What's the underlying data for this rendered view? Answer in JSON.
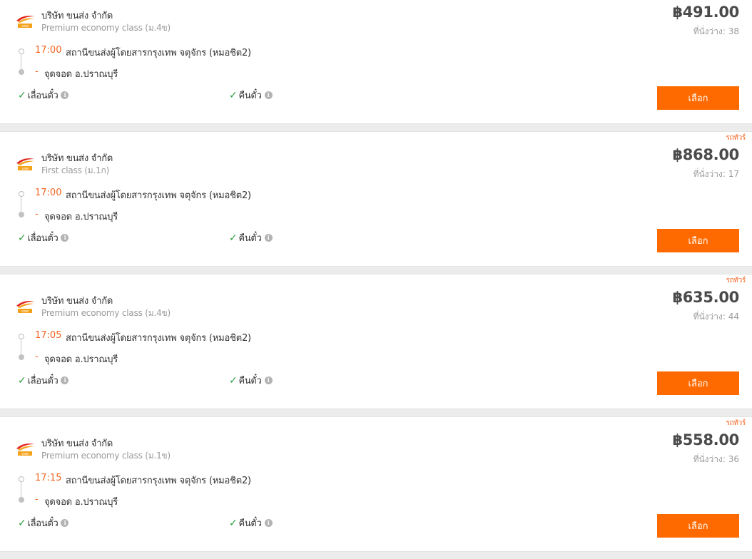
{
  "trips": [
    {
      "ribbon": "",
      "company": "บริษัท ขนส่ง จำกัด",
      "bus_class": "Premium economy class (ม.4ข)",
      "departure_time": "17:00",
      "departure_station": "สถานีขนส่งผู้โดยสารกรุงเทพ จตุจักร (หมอชิต2)",
      "arrival_time": "-",
      "arrival_station": "จุดจอด อ.ปราณบุรี",
      "feature_1": "เลื่อนตั๋ว",
      "feature_2": "คืนตั๋ว",
      "price": "฿491.00",
      "seats": "ที่นั่งว่าง: 38",
      "button_label": "เลือก"
    },
    {
      "ribbon": "รถทัวร์",
      "company": "บริษัท ขนส่ง จำกัด",
      "bus_class": "First class (ม.1ก)",
      "departure_time": "17:00",
      "departure_station": "สถานีขนส่งผู้โดยสารกรุงเทพ จตุจักร (หมอชิต2)",
      "arrival_time": "-",
      "arrival_station": "จุดจอด อ.ปราณบุรี",
      "feature_1": "เลื่อนตั๋ว",
      "feature_2": "คืนตั๋ว",
      "price": "฿868.00",
      "seats": "ที่นั่งว่าง: 17",
      "button_label": "เลือก"
    },
    {
      "ribbon": "รถทัวร์",
      "company": "บริษัท ขนส่ง จำกัด",
      "bus_class": "Premium economy class (ม.4ข)",
      "departure_time": "17:05",
      "departure_station": "สถานีขนส่งผู้โดยสารกรุงเทพ จตุจักร (หมอชิต2)",
      "arrival_time": "-",
      "arrival_station": "จุดจอด อ.ปราณบุรี",
      "feature_1": "เลื่อนตั๋ว",
      "feature_2": "คืนตั๋ว",
      "price": "฿635.00",
      "seats": "ที่นั่งว่าง: 44",
      "button_label": "เลือก"
    },
    {
      "ribbon": "รถทัวร์",
      "company": "บริษัท ขนส่ง จำกัด",
      "bus_class": "Premium economy class (ม.1ข)",
      "departure_time": "17:15",
      "departure_station": "สถานีขนส่งผู้โดยสารกรุงเทพ จตุจักร (หมอชิต2)",
      "arrival_time": "-",
      "arrival_station": "จุดจอด อ.ปราณบุรี",
      "feature_1": "เลื่อนตั๋ว",
      "feature_2": "คืนตั๋ว",
      "price": "฿558.00",
      "seats": "ที่นั่งว่าง: 36",
      "button_label": "เลือก"
    }
  ],
  "icons": {
    "logo": "bus-company-logo-icon",
    "check": "check-icon",
    "info": "info-icon"
  },
  "colors": {
    "accent": "#ff6a00",
    "time": "#f26522",
    "check": "#2e9e3e",
    "logo_red": "#e0251b",
    "logo_orange": "#f5a21b"
  }
}
